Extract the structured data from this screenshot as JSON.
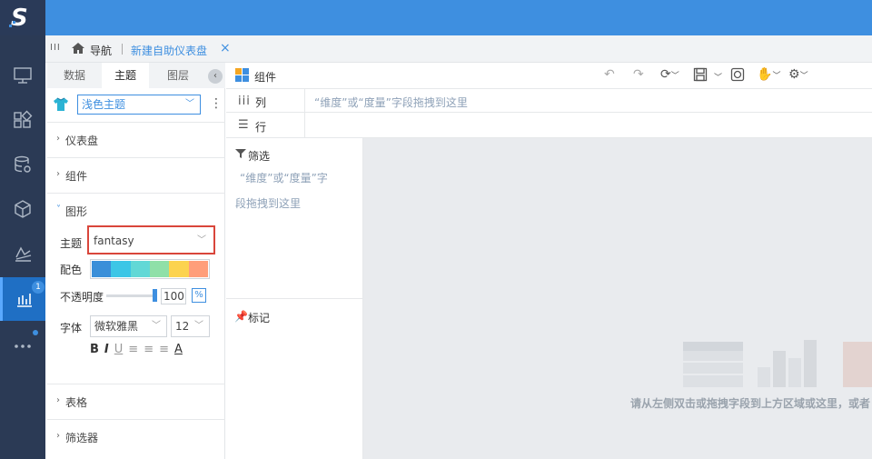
{
  "app": {
    "logo_text": "S"
  },
  "nav": {
    "items": [
      {
        "name": "monitor",
        "badge": ""
      },
      {
        "name": "apps",
        "badge": ""
      },
      {
        "name": "database-settings",
        "badge": ""
      },
      {
        "name": "cube",
        "badge": ""
      },
      {
        "name": "chart-line",
        "badge": ""
      },
      {
        "name": "dashboard",
        "badge": "1"
      },
      {
        "name": "more",
        "badge": ""
      }
    ]
  },
  "tabs": {
    "menu_icon": "III",
    "home_label": "导航",
    "active_tab": "新建自助仪表盘",
    "close": "×"
  },
  "panel": {
    "tabs": [
      "数据",
      "主题",
      "图层"
    ],
    "theme_select": "浅色主题",
    "sections": {
      "dashboard": "仪表盘",
      "component": "组件",
      "graphic": "图形",
      "table": "表格",
      "filter": "筛选器"
    },
    "graphic": {
      "theme_label": "主题",
      "theme_value": "fantasy",
      "palette_label": "配色",
      "palette": [
        "#3a8fd9",
        "#3cc6e6",
        "#62d8d6",
        "#8fe0a8",
        "#fcd34f",
        "#ff9e7a"
      ],
      "opacity_label": "不透明度",
      "opacity_value": "100",
      "opacity_unit": "%",
      "font_label": "字体",
      "font_value": "微软雅黑",
      "font_size": "12",
      "format_buttons": [
        "B",
        "I",
        "U",
        "≡",
        "≡",
        "≡",
        "A"
      ]
    }
  },
  "editor": {
    "component_label": "组件",
    "col_label": "列",
    "row_label": "行",
    "drop_hint_dims": "“维度”或“度量”字段拖拽到这里",
    "filter_label": "筛选",
    "filter_hint_line1": "“维度”或“度量”字",
    "filter_hint_line2": "段拖拽到这里",
    "mark_label": "标记",
    "canvas_hint": "请从左侧双击或拖拽字段到上方区域或这里，或者"
  },
  "colors": {
    "accent": "#3e8fe0",
    "nav_bg": "#2b3a55",
    "highlight": "#d9463b"
  }
}
